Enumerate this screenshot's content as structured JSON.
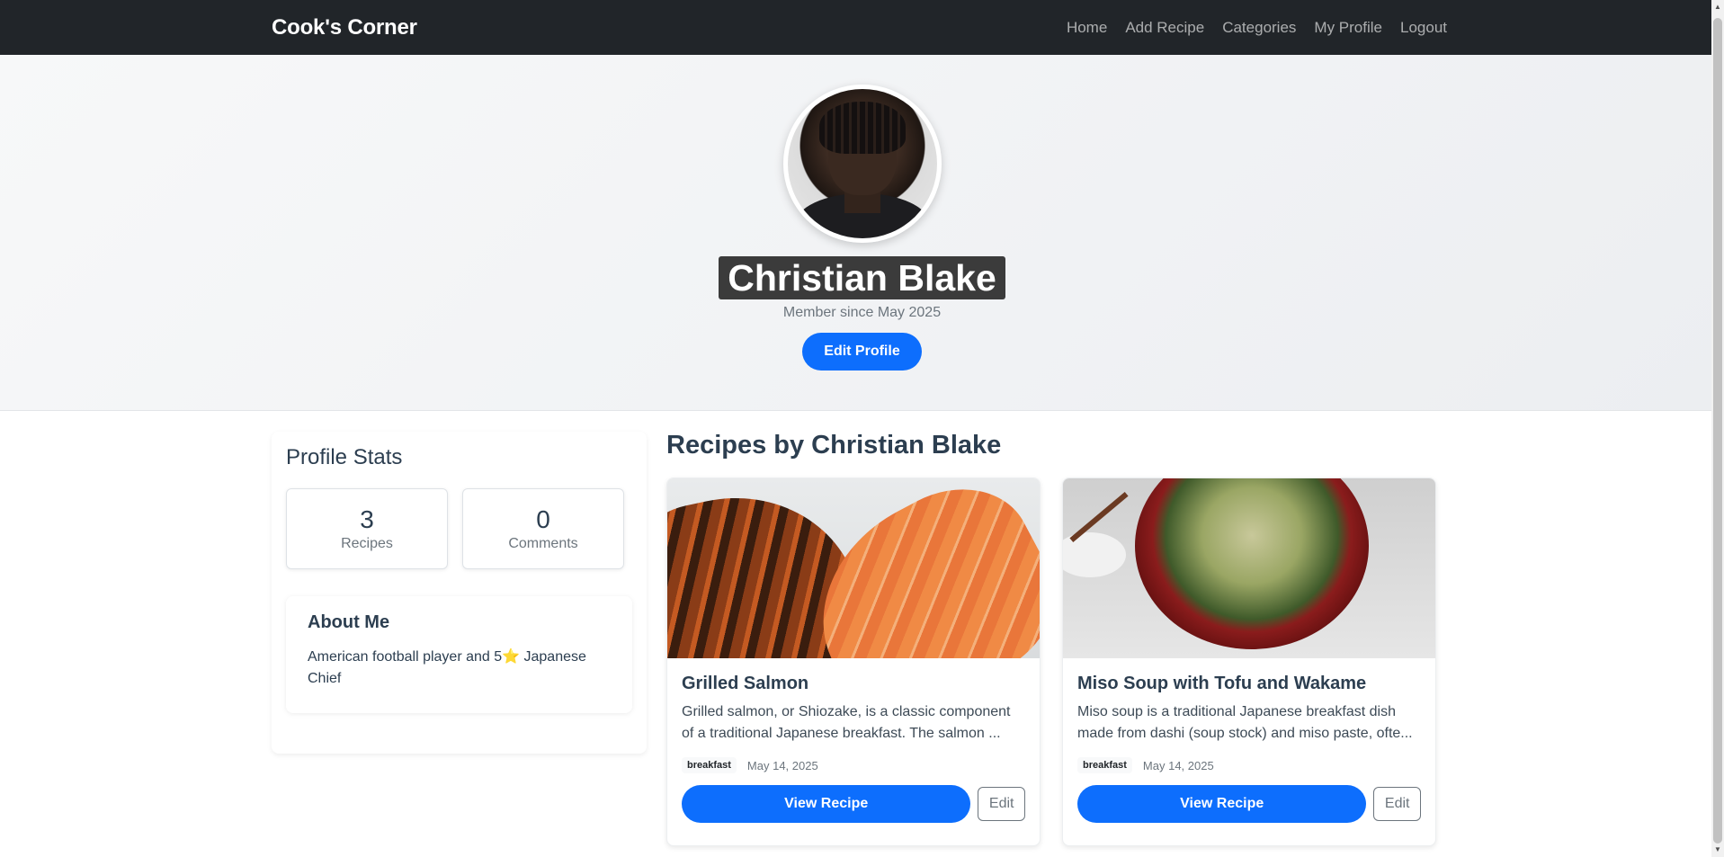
{
  "navbar": {
    "brand": "Cook's Corner",
    "links": [
      "Home",
      "Add Recipe",
      "Categories",
      "My Profile",
      "Logout"
    ]
  },
  "profile": {
    "name": "Christian Blake",
    "member_since": "Member since May 2025",
    "edit_button": "Edit Profile",
    "avatar_icon": "user-avatar-photo"
  },
  "stats": {
    "title": "Profile Stats",
    "recipes_value": "3",
    "recipes_label": "Recipes",
    "comments_value": "0",
    "comments_label": "Comments"
  },
  "about": {
    "title": "About Me",
    "text": "American football player and 5⭐ Japanese Chief"
  },
  "recipes": {
    "heading": "Recipes by Christian Blake",
    "items": [
      {
        "title": "Grilled Salmon",
        "description": "Grilled salmon, or Shiozake, is a classic component of a traditional Japanese breakfast. The salmon ...",
        "category": "breakfast",
        "date": "May 14, 2025",
        "view_label": "View Recipe",
        "edit_label": "Edit"
      },
      {
        "title": "Miso Soup with Tofu and Wakame",
        "description": "Miso soup is a traditional Japanese breakfast dish made from dashi (soup stock) and miso paste, ofte...",
        "category": "breakfast",
        "date": "May 14, 2025",
        "view_label": "View Recipe",
        "edit_label": "Edit"
      }
    ]
  },
  "colors": {
    "navbar_bg": "#212529",
    "primary": "#0d6efd",
    "heading": "#2c3e50"
  }
}
